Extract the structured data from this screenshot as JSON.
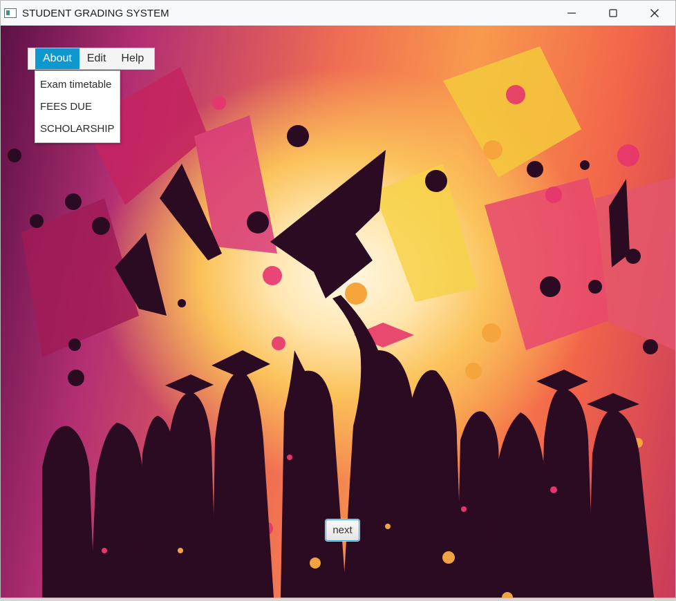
{
  "window": {
    "title": "STUDENT GRADING SYSTEM",
    "controls": [
      "minimize-icon",
      "maximize-icon",
      "close-icon"
    ]
  },
  "menubar": {
    "items": [
      {
        "label": "About",
        "active": true
      },
      {
        "label": "Edit",
        "active": false
      },
      {
        "label": "Help",
        "active": false
      }
    ]
  },
  "about_menu": {
    "items": [
      "Exam timetable",
      "FEES DUE",
      "SCHOLARSHIP"
    ]
  },
  "background": {
    "description_icon": "graduation-celebration-image",
    "colors": {
      "magenta": "#b22e73",
      "orange": "#f06f52",
      "yellow": "#fbc25a",
      "silhouette": "#2b0b22"
    }
  },
  "next_button": {
    "label": "next"
  },
  "accent_color": "#0f97cf"
}
